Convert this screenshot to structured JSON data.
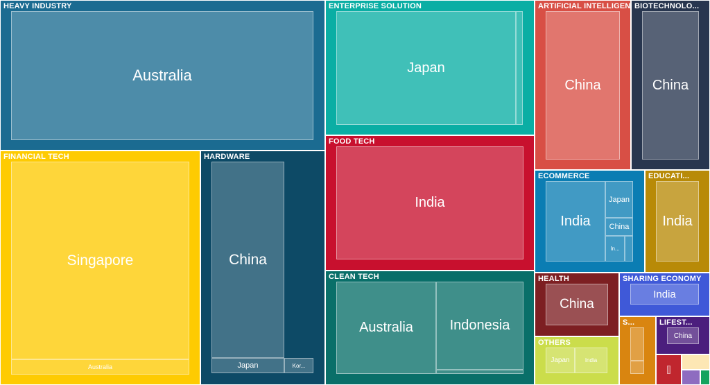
{
  "chart_data": {
    "type": "treemap",
    "sectors": [
      {
        "name": "HEAVY INDUSTRY",
        "color": "#1b6b91",
        "countries": [
          {
            "name": "Australia"
          }
        ]
      },
      {
        "name": "ENTERPRISE SOLUTION",
        "color": "#0aaea4",
        "countries": [
          {
            "name": "Japan"
          },
          {
            "name": ""
          }
        ]
      },
      {
        "name": "ARTIFICIAL INTELLIGEN...",
        "color": "#d84f45",
        "countries": [
          {
            "name": "China"
          }
        ]
      },
      {
        "name": "BIOTECHNOLO...",
        "color": "#28364f",
        "countries": [
          {
            "name": "China"
          }
        ]
      },
      {
        "name": "FINANCIAL TECH",
        "color": "#fecb02",
        "countries": [
          {
            "name": "Singapore"
          },
          {
            "name": "Australia"
          }
        ]
      },
      {
        "name": "HARDWARE",
        "color": "#0d4a66",
        "countries": [
          {
            "name": "China"
          },
          {
            "name": "Japan"
          },
          {
            "name": "Kor..."
          }
        ]
      },
      {
        "name": "FOOD TECH",
        "color": "#c8102e",
        "countries": [
          {
            "name": "India"
          }
        ]
      },
      {
        "name": "CLEAN TECH",
        "color": "#096f69",
        "countries": [
          {
            "name": "Australia"
          },
          {
            "name": "Indonesia"
          },
          {
            "name": ""
          }
        ]
      },
      {
        "name": "ECOMMERCE",
        "color": "#0b7db3",
        "countries": [
          {
            "name": "India"
          },
          {
            "name": "Japan"
          },
          {
            "name": "China"
          },
          {
            "name": "In..."
          },
          {
            "name": ""
          }
        ]
      },
      {
        "name": "EDUCATI...",
        "color": "#b88a07",
        "countries": [
          {
            "name": "India"
          }
        ]
      },
      {
        "name": "HEALTH",
        "color": "#7d1f22",
        "countries": [
          {
            "name": "China"
          }
        ]
      },
      {
        "name": "SHARING ECONOMY",
        "color": "#3f59d8",
        "countries": [
          {
            "name": "India"
          }
        ]
      },
      {
        "name": "OTHERS",
        "color": "#cbdd4b",
        "countries": [
          {
            "name": "Japan"
          },
          {
            "name": "India"
          }
        ]
      },
      {
        "name": "S...",
        "color": "#d98510",
        "countries": [
          {
            "name": ""
          },
          {
            "name": ""
          }
        ]
      },
      {
        "name": "LIFEST...",
        "color": "#4b1e7d",
        "countries": [
          {
            "name": "China"
          }
        ]
      },
      {
        "name": "",
        "color": "#c0262e",
        "countries": [
          {
            "name": ""
          }
        ]
      },
      {
        "name": "",
        "color": "#fde7b4",
        "countries": []
      },
      {
        "name": "",
        "color": "#8e6cc0",
        "countries": []
      },
      {
        "name": "",
        "color": "#13a35e",
        "countries": []
      }
    ]
  }
}
